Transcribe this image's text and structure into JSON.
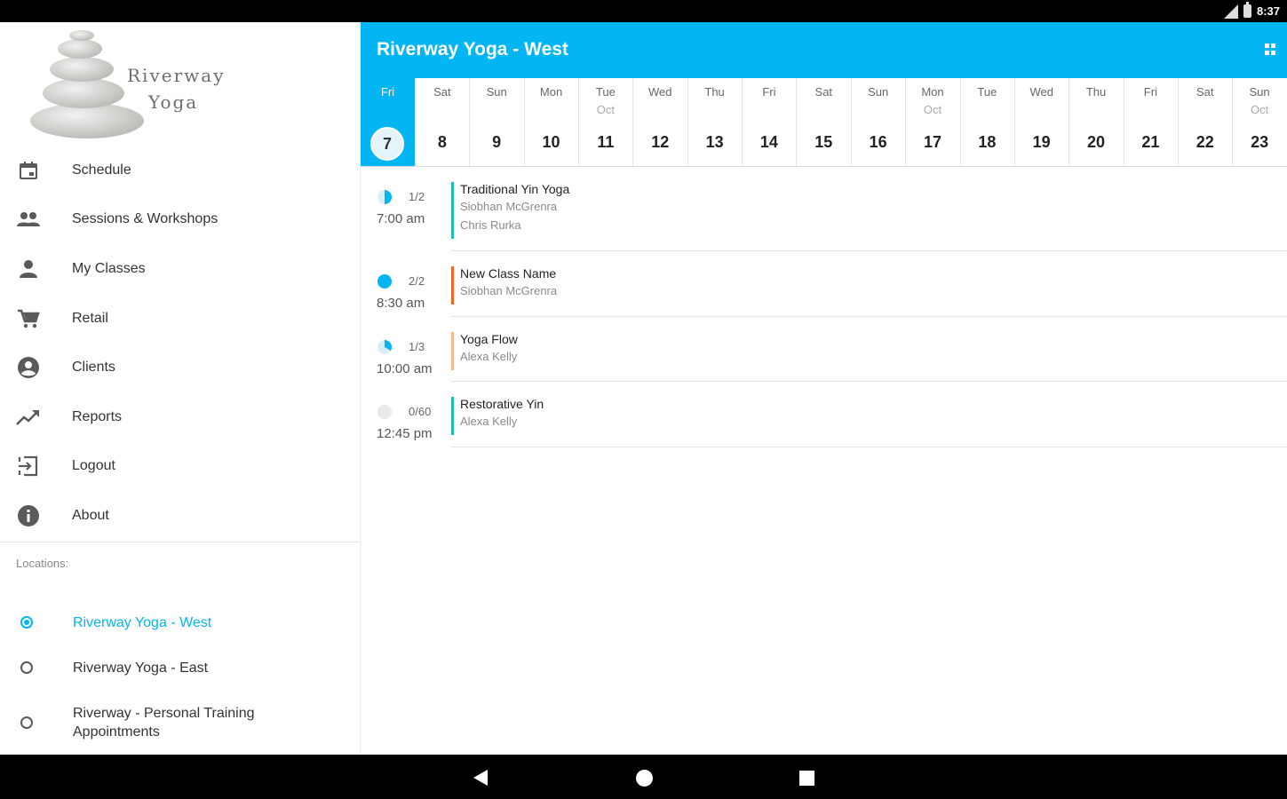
{
  "status_bar": {
    "time": "8:37"
  },
  "drawer": {
    "logo_line1": "Riverway",
    "logo_line2": "Yoga",
    "nav_items": [
      {
        "label": "Schedule",
        "icon": "calendar-icon"
      },
      {
        "label": "Sessions & Workshops",
        "icon": "people-icon"
      },
      {
        "label": "My Classes",
        "icon": "person-icon"
      },
      {
        "label": "Retail",
        "icon": "cart-icon"
      },
      {
        "label": "Clients",
        "icon": "account-circle-icon"
      },
      {
        "label": "Reports",
        "icon": "trending-up-icon"
      },
      {
        "label": "Logout",
        "icon": "logout-icon"
      },
      {
        "label": "About",
        "icon": "info-icon"
      }
    ],
    "locations_header": "Locations:",
    "locations": [
      {
        "label": "Riverway Yoga - West",
        "selected": true
      },
      {
        "label": "Riverway Yoga - East",
        "selected": false
      },
      {
        "label": "Riverway - Personal Training Appointments",
        "selected": false
      }
    ]
  },
  "app_bar": {
    "title": "Riverway Yoga - West",
    "accent_color": "#03b5f3"
  },
  "dates": [
    {
      "day": "Fri",
      "month": "",
      "num": "7",
      "selected": true
    },
    {
      "day": "Sat",
      "month": "",
      "num": "8"
    },
    {
      "day": "Sun",
      "month": "",
      "num": "9"
    },
    {
      "day": "Mon",
      "month": "",
      "num": "10"
    },
    {
      "day": "Tue",
      "month": "Oct",
      "num": "11"
    },
    {
      "day": "Wed",
      "month": "",
      "num": "12"
    },
    {
      "day": "Thu",
      "month": "",
      "num": "13"
    },
    {
      "day": "Fri",
      "month": "",
      "num": "14"
    },
    {
      "day": "Sat",
      "month": "",
      "num": "15"
    },
    {
      "day": "Sun",
      "month": "",
      "num": "16"
    },
    {
      "day": "Mon",
      "month": "Oct",
      "num": "17"
    },
    {
      "day": "Tue",
      "month": "",
      "num": "18"
    },
    {
      "day": "Wed",
      "month": "",
      "num": "19"
    },
    {
      "day": "Thu",
      "month": "",
      "num": "20"
    },
    {
      "day": "Fri",
      "month": "",
      "num": "21"
    },
    {
      "day": "Sat",
      "month": "",
      "num": "22"
    },
    {
      "day": "Sun",
      "month": "Oct",
      "num": "23"
    }
  ],
  "classes": [
    {
      "capacity": "1/2",
      "fill_fraction": 0.5,
      "time": "7:00 am",
      "name": "Traditional Yin Yoga",
      "instructors": [
        "Siobhan McGrenra",
        "Chris Rurka"
      ],
      "bar_color": "#19c1b0"
    },
    {
      "capacity": "2/2",
      "fill_fraction": 1.0,
      "time": "8:30 am",
      "name": "New Class Name",
      "instructors": [
        "Siobhan McGrenra"
      ],
      "bar_color": "#f26522"
    },
    {
      "capacity": "1/3",
      "fill_fraction": 0.333,
      "time": "10:00 am",
      "name": "Yoga Flow",
      "instructors": [
        "Alexa Kelly"
      ],
      "bar_color": "#f9b98a"
    },
    {
      "capacity": "0/60",
      "fill_fraction": 0.0,
      "time": "12:45 pm",
      "name": "Restorative Yin",
      "instructors": [
        "Alexa Kelly"
      ],
      "bar_color": "#19c1b0"
    }
  ]
}
